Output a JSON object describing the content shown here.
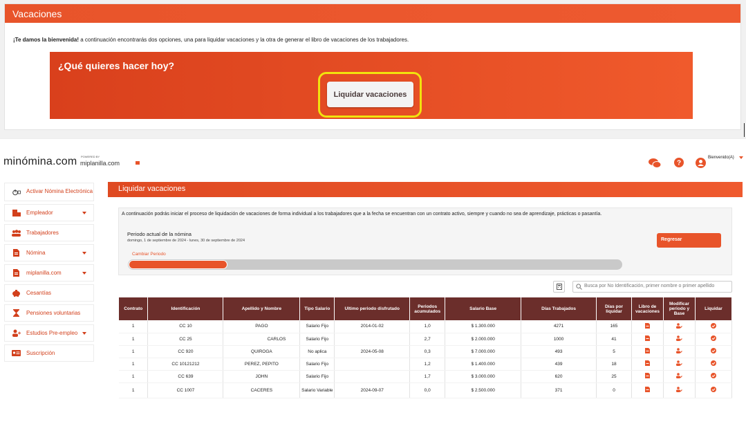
{
  "top": {
    "title": "Vacaciones",
    "welcome_bold": "¡Te damos la bienvenida!",
    "welcome_rest": " a continuación encontrarás dos opciones, una para liquidar vacaciones y la otra de generar el libro de vacaciones de los trabajadores.",
    "hero_title": "¿Qué quieres hacer hoy?",
    "hero_button": "Liquidar vacaciones"
  },
  "header": {
    "logo": "minómina.com",
    "powered_by": "POWERED BY",
    "sublogo": "miplanilla.com",
    "greeting": "Bienvenido(A)"
  },
  "sidebar": {
    "items": [
      {
        "label": "Activar Nómina Electrónica",
        "icon": "power-icon",
        "caret": false
      },
      {
        "label": "Empleador",
        "icon": "employer-icon",
        "caret": true
      },
      {
        "label": "Trabajadores",
        "icon": "workers-icon",
        "caret": false
      },
      {
        "label": "Nómina",
        "icon": "document-icon",
        "caret": true
      },
      {
        "label": "miplanilla.com",
        "icon": "document-icon",
        "caret": true
      },
      {
        "label": "Cesantías",
        "icon": "piggy-bank-icon",
        "caret": false
      },
      {
        "label": "Pensiones voluntarias",
        "icon": "hourglass-icon",
        "caret": false
      },
      {
        "label": "Estudios Pre-empleo",
        "icon": "user-plus-icon",
        "caret": true
      },
      {
        "label": "Suscripción",
        "icon": "id-card-icon",
        "caret": false
      }
    ]
  },
  "main": {
    "title": "Liquidar vacaciones",
    "intro": "A continuación podrás iniciar el proceso de liquidación de vacaciones de forma individual a los trabajadores que a la fecha se encuentran con un contrato activo, siempre y cuando no sea de aprendizaje, prácticas o pasantía.",
    "period_title": "Periodo actual de la nómina",
    "period_dates": "domingo, 1 de septiembre de 2024 - lunes, 30 de septiembre de 2024",
    "back_button": "Regresar",
    "change_period": "Cambiar Periodo",
    "progress_fraction": 0.2,
    "search_placeholder": "Busca por No Identificación, primer nombre o primer apellido",
    "table": {
      "headers": [
        "Contrato",
        "Identificación",
        "Apellido y Nombre",
        "Tipo Salario",
        "Ultimo periodo disfrutado",
        "Periodos acumulados",
        "Salario Base",
        "Días Trabajados",
        "Días por liquidar",
        "Libro de vacaciones",
        "Modificar periodo y Base",
        "Liquidar"
      ],
      "rows": [
        [
          "1",
          "CC 10",
          "PAGO",
          "Salario Fijo",
          "2014-01-02",
          "1,0",
          "$ 1.300.000",
          "4271",
          "165"
        ],
        [
          "1",
          "CC 25",
          "CARLOS",
          "Salario Fijo",
          "",
          "2,7",
          "$ 2.000.000",
          "1000",
          "41"
        ],
        [
          "1",
          "CC            920",
          "QUIROGA",
          "No aplica",
          "2024-05-08",
          "0,3",
          "$ 7.000.000",
          "493",
          "5"
        ],
        [
          "1",
          "CC 10121212",
          "PEREZ, PEPITO",
          "Salario Fijo",
          "",
          "1,2",
          "$ 1.400.000",
          "439",
          "18"
        ],
        [
          "1",
          "CC 639",
          "JOHN",
          "Salario Fijo",
          "",
          "1,7",
          "$ 3.000.000",
          "620",
          "25"
        ],
        [
          "1",
          "CC 1007",
          "CACERES",
          "Salario Variable",
          "2024-09-07",
          "0,0",
          "$ 2.500.000",
          "371",
          "0"
        ]
      ]
    }
  },
  "colors": {
    "brand": "#e8542a",
    "table_header": "#6b2e2b",
    "highlight": "#f1e30e"
  }
}
